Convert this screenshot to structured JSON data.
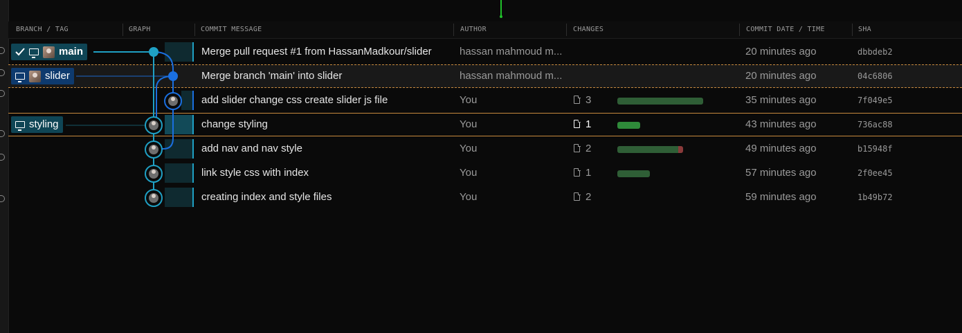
{
  "header": {
    "branch_tag": "BRANCH / TAG",
    "graph": "GRAPH",
    "commit_message": "COMMIT MESSAGE",
    "author": "AUTHOR",
    "changes": "CHANGES",
    "commit_date": "COMMIT DATE / TIME",
    "sha": "SHA"
  },
  "labels": {
    "main": "main",
    "slider": "slider",
    "styling": "styling"
  },
  "commits": [
    {
      "message": "Merge pull request #1 from HassanMadkour/slider",
      "author": "hassan mahmoud m...",
      "changes": "",
      "date": "20 minutes ago",
      "sha": "dbbdeb2"
    },
    {
      "message": "Merge branch 'main' into slider",
      "author": "hassan mahmoud m...",
      "changes": "",
      "date": "20 minutes ago",
      "sha": "04c6806"
    },
    {
      "message": "add slider change css create slider js file",
      "author": "You",
      "changes": "3",
      "date": "35 minutes ago",
      "sha": "7f049e5"
    },
    {
      "message": "change styling",
      "author": "You",
      "changes": "1",
      "date": "43 minutes ago",
      "sha": "736ac88"
    },
    {
      "message": "add nav and nav style",
      "author": "You",
      "changes": "2",
      "date": "49 minutes ago",
      "sha": "b15948f"
    },
    {
      "message": "link style css with index",
      "author": "You",
      "changes": "1",
      "date": "57 minutes ago",
      "sha": "2f0ee45"
    },
    {
      "message": "creating index and style files",
      "author": "You",
      "changes": "2",
      "date": "59 minutes ago",
      "sha": "1b49b72"
    }
  ],
  "change_bars": [
    {
      "added": 1.0,
      "deleted": 0.0
    },
    {
      "added": 0.26,
      "deleted": 0.0
    },
    {
      "added": 0.7,
      "deleted": 0.05
    },
    {
      "added": 0.37,
      "deleted": 0.0
    }
  ],
  "colors": {
    "background": "#0a0a0a",
    "graph_blue": "#1a6fe0",
    "graph_cyan": "#1fa0c4",
    "label_bg": "#0f4555",
    "selection_border": "#c98a3e",
    "added": "#2f5e36",
    "deleted": "#8a3a3a",
    "top_indicator": "#20c02a"
  },
  "icons": [
    "check-icon",
    "monitor-icon",
    "avatar",
    "file-icon"
  ]
}
